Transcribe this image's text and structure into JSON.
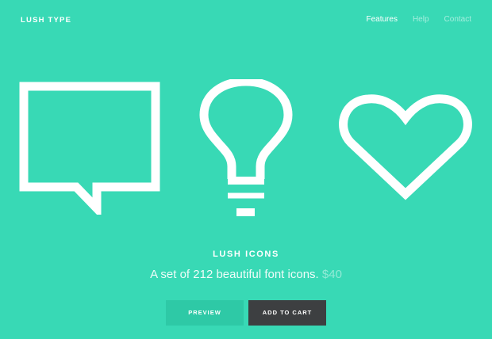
{
  "header": {
    "logo": "LUSH TYPE",
    "nav": [
      {
        "label": "Features",
        "active": true
      },
      {
        "label": "Help",
        "active": false
      },
      {
        "label": "Contact",
        "active": false
      }
    ]
  },
  "hero": {
    "icons": [
      "speech-bubble-icon",
      "lightbulb-icon",
      "heart-icon"
    ]
  },
  "product": {
    "name": "LUSH ICONS",
    "description": "A set of 212 beautiful font icons.",
    "price": "$40"
  },
  "actions": {
    "preview_label": "PREVIEW",
    "cart_label": "ADD TO CART"
  },
  "colors": {
    "background": "#38d9b5",
    "preview_button": "#2ec9a6",
    "cart_button": "#3d3f41",
    "text": "#ffffff"
  }
}
